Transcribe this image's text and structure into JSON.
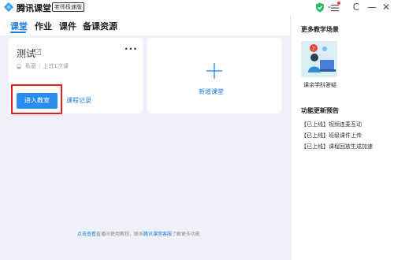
{
  "window": {
    "app_name": "腾讯课堂",
    "edition_badge": "老师极速版",
    "controls": {
      "minimize": "—",
      "maximize": "☐",
      "close": "✕",
      "refresh": "C"
    }
  },
  "tabs": [
    {
      "label": "课堂",
      "active": true
    },
    {
      "label": "作业",
      "active": false
    },
    {
      "label": "课件",
      "active": false
    },
    {
      "label": "备课资源",
      "active": false
    }
  ],
  "course_card": {
    "title": "测试",
    "more": "···",
    "privacy": "私密",
    "separator": "|",
    "last_class": "上过1次课",
    "enter_button": "进入教室",
    "record_link": "课程记录"
  },
  "new_course": {
    "label": "新增课堂"
  },
  "footer": {
    "link1": "点击查看",
    "text1": "直播间使用教程，联系",
    "link2": "腾讯课堂客服",
    "text2": "了解更多功能"
  },
  "right_panel": {
    "scenes_title": "更多教学场景",
    "scene_label": "课余学科答疑",
    "updates_title": "功能更新预告",
    "updates": [
      "【已上线】视频连麦互动",
      "【已上线】班级课件上传",
      "【已上线】课程回放生成加速"
    ]
  },
  "colors": {
    "accent": "#1f7be8",
    "button": "#2b8cf0",
    "highlight": "#e02020",
    "background": "#eef2f8"
  }
}
